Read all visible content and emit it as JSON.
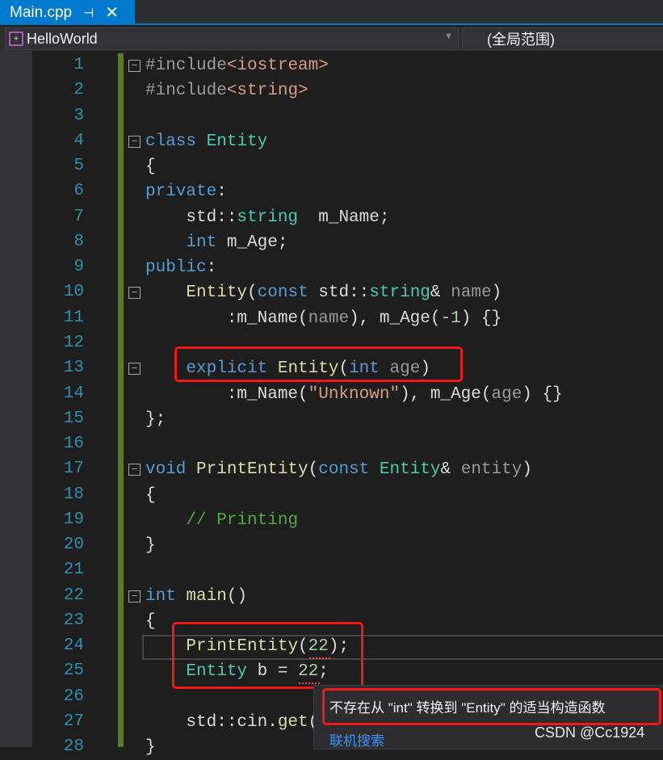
{
  "tab": {
    "title": "Main.cpp",
    "pin_icon": "pin-icon",
    "close_icon": "close-icon"
  },
  "navbar": {
    "project": "HelloWorld",
    "scope": "(全局范围)"
  },
  "code": [
    [
      [
        "#include",
        "pp"
      ],
      [
        "<iostream>",
        "st"
      ]
    ],
    [
      [
        "#include",
        "pp"
      ],
      [
        "<string>",
        "st"
      ]
    ],
    [],
    [
      [
        "class ",
        "kw"
      ],
      [
        "Entity",
        "ty"
      ]
    ],
    [
      [
        "{",
        "pl"
      ]
    ],
    [
      [
        "private",
        "kw"
      ],
      [
        ":",
        "pl"
      ]
    ],
    [
      [
        "    std::",
        "pl"
      ],
      [
        "string",
        "ty"
      ],
      [
        "  m_Name;",
        "pl"
      ]
    ],
    [
      [
        "    ",
        "pl"
      ],
      [
        "int",
        "kw"
      ],
      [
        " m_Age;",
        "pl"
      ]
    ],
    [
      [
        "public",
        "kw"
      ],
      [
        ":",
        "pl"
      ]
    ],
    [
      [
        "    ",
        "pl"
      ],
      [
        "Entity",
        "fn"
      ],
      [
        "(",
        "pl"
      ],
      [
        "const",
        "kw"
      ],
      [
        " std::",
        "pl"
      ],
      [
        "string",
        "ty"
      ],
      [
        "& ",
        "pl"
      ],
      [
        "name",
        "pa"
      ],
      [
        ")",
        "pl"
      ]
    ],
    [
      [
        "        :m_Name(",
        "pl"
      ],
      [
        "name",
        "pa"
      ],
      [
        "), m_Age(",
        "pl"
      ],
      [
        "-1",
        "nu"
      ],
      [
        ") {}",
        "pl"
      ]
    ],
    [],
    [
      [
        "    ",
        "pl"
      ],
      [
        "explicit ",
        "kw"
      ],
      [
        "Entity",
        "fn"
      ],
      [
        "(",
        "pl"
      ],
      [
        "int ",
        "kw"
      ],
      [
        "age",
        "pa"
      ],
      [
        ")",
        "pl"
      ]
    ],
    [
      [
        "        :m_Name(",
        "pl"
      ],
      [
        "\"Unknown\"",
        "st"
      ],
      [
        "), m_Age(",
        "pl"
      ],
      [
        "age",
        "pa"
      ],
      [
        ") {}",
        "pl"
      ]
    ],
    [
      [
        "};",
        "pl"
      ]
    ],
    [],
    [
      [
        "void ",
        "kw"
      ],
      [
        "PrintEntity",
        "fn"
      ],
      [
        "(",
        "pl"
      ],
      [
        "const ",
        "kw"
      ],
      [
        "Entity",
        "ty"
      ],
      [
        "& ",
        "pl"
      ],
      [
        "entity",
        "pa"
      ],
      [
        ")",
        "pl"
      ]
    ],
    [
      [
        "{",
        "pl"
      ]
    ],
    [
      [
        "    ",
        "pl"
      ],
      [
        "// Printing",
        "cm"
      ]
    ],
    [
      [
        "}",
        "pl"
      ]
    ],
    [],
    [
      [
        "int ",
        "kw"
      ],
      [
        "main",
        "fn"
      ],
      [
        "()",
        "pl"
      ]
    ],
    [
      [
        "{",
        "pl"
      ]
    ],
    [
      [
        "    ",
        "pl"
      ],
      [
        "PrintEntity",
        "fn"
      ],
      [
        "(",
        "pl"
      ],
      [
        "22",
        "nu"
      ],
      [
        ");",
        "pl"
      ]
    ],
    [
      [
        "    ",
        "pl"
      ],
      [
        "Entity",
        "ty"
      ],
      [
        " b = ",
        "pl"
      ],
      [
        "22",
        "nu"
      ],
      [
        ";",
        "pl"
      ]
    ],
    [],
    [
      [
        "    std::cin.",
        "pl"
      ],
      [
        "get",
        "fn"
      ],
      [
        "(",
        "pl"
      ]
    ],
    [
      [
        "}",
        "pl"
      ]
    ]
  ],
  "folds": [
    1,
    4,
    10,
    13,
    17,
    22
  ],
  "tooltip": {
    "message": "不存在从 \"int\" 转换到 \"Entity\" 的适当构造函数",
    "link": "联机搜索"
  },
  "watermark": "CSDN @Cc1924"
}
